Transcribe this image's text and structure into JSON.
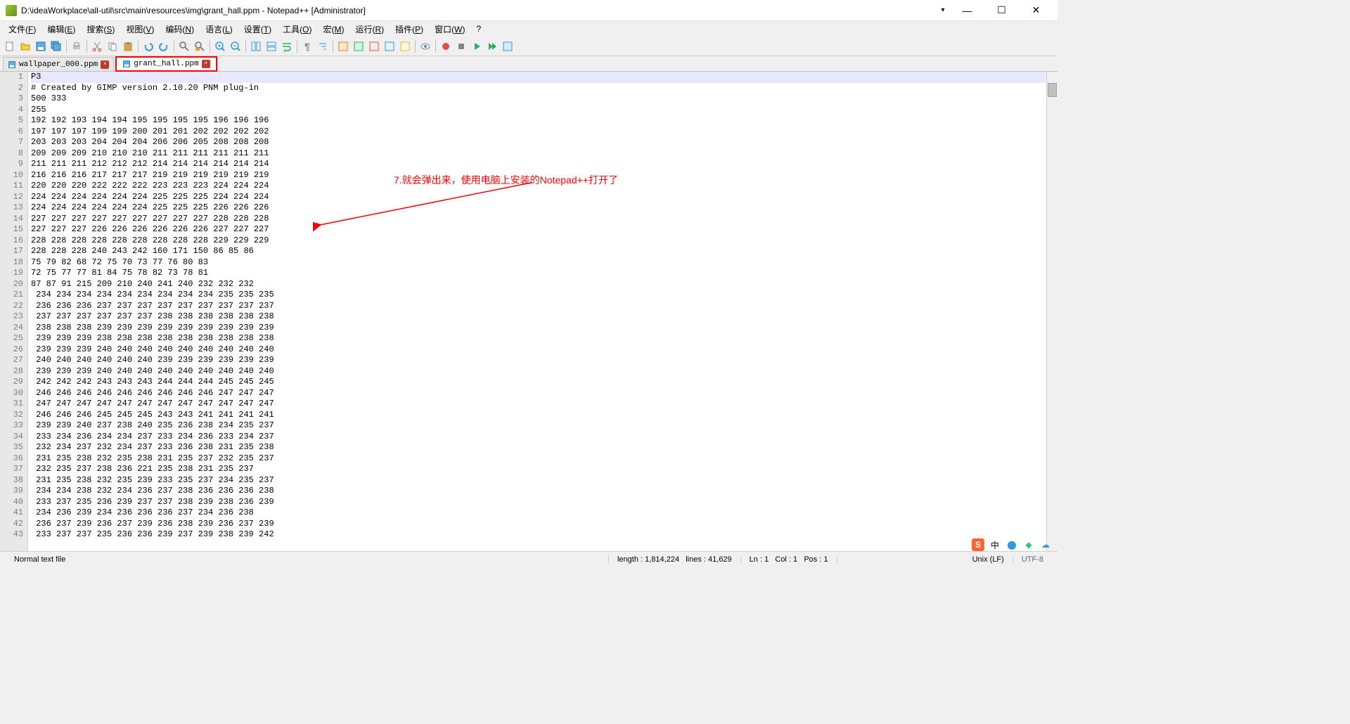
{
  "title": "D:\\ideaWorkplace\\all-util\\src\\main\\resources\\img\\grant_hall.ppm - Notepad++ [Administrator]",
  "menus": [
    {
      "label": "文件(F)",
      "key": "F"
    },
    {
      "label": "编辑(E)",
      "key": "E"
    },
    {
      "label": "搜索(S)",
      "key": "S"
    },
    {
      "label": "视图(V)",
      "key": "V"
    },
    {
      "label": "编码(N)",
      "key": "N"
    },
    {
      "label": "语言(L)",
      "key": "L"
    },
    {
      "label": "设置(T)",
      "key": "T"
    },
    {
      "label": "工具(O)",
      "key": "O"
    },
    {
      "label": "宏(M)",
      "key": "M"
    },
    {
      "label": "运行(R)",
      "key": "R"
    },
    {
      "label": "插件(P)",
      "key": "P"
    },
    {
      "label": "窗口(W)",
      "key": "W"
    },
    {
      "label": "?",
      "key": ""
    }
  ],
  "tabs": [
    {
      "name": "wallpaper_000.ppm",
      "active": false
    },
    {
      "name": "grant_hall.ppm",
      "active": true
    }
  ],
  "lines": [
    "P3",
    "# Created by GIMP version 2.10.20 PNM plug-in",
    "500 333",
    "255",
    "192 192 193 194 194 195 195 195 195 196 196 196",
    "197 197 197 199 199 200 201 201 202 202 202 202",
    "203 203 203 204 204 204 206 206 205 208 208 208",
    "209 209 209 210 210 210 211 211 211 211 211 211",
    "211 211 211 212 212 212 214 214 214 214 214 214",
    "216 216 216 217 217 217 219 219 219 219 219 219",
    "220 220 220 222 222 222 223 223 223 224 224 224",
    "224 224 224 224 224 224 225 225 225 224 224 224",
    "224 224 224 224 224 224 225 225 225 226 226 226",
    "227 227 227 227 227 227 227 227 227 228 228 228",
    "227 227 227 226 226 226 226 226 226 227 227 227",
    "228 228 228 228 228 228 228 228 228 229 229 229",
    "228 228 228 240 243 242 160 171 150 86 85 86",
    "75 79 82 68 72 75 70 73 77 76 80 83",
    "72 75 77 77 81 84 75 78 82 73 78 81",
    "87 87 91 215 209 210 240 241 240 232 232 232",
    " 234 234 234 234 234 234 234 234 234 235 235 235",
    " 236 236 236 237 237 237 237 237 237 237 237 237",
    " 237 237 237 237 237 237 238 238 238 238 238 238",
    " 238 238 238 239 239 239 239 239 239 239 239 239",
    " 239 239 239 238 238 238 238 238 238 238 238 238",
    " 239 239 239 240 240 240 240 240 240 240 240 240",
    " 240 240 240 240 240 240 239 239 239 239 239 239",
    " 239 239 239 240 240 240 240 240 240 240 240 240",
    " 242 242 242 243 243 243 244 244 244 245 245 245",
    " 246 246 246 246 246 246 246 246 246 247 247 247",
    " 247 247 247 247 247 247 247 247 247 247 247 247",
    " 246 246 246 245 245 245 243 243 241 241 241 241",
    " 239 239 240 237 238 240 235 236 238 234 235 237",
    " 233 234 236 234 234 237 233 234 236 233 234 237",
    " 232 234 237 232 234 237 233 236 238 231 235 238",
    " 231 235 238 232 235 238 231 235 237 232 235 237",
    " 232 235 237 238 236 221 235 238 231 235 237",
    " 231 235 238 232 235 239 233 235 237 234 235 237",
    " 234 234 238 232 234 236 237 238 236 236 236 238",
    " 233 237 235 236 239 237 237 238 239 238 236 239",
    " 234 236 239 234 236 236 236 237 234 236 238",
    " 236 237 239 236 237 239 236 238 239 236 237 239",
    " 233 237 237 235 236 236 239 237 239 238 239 242"
  ],
  "annotation": "7.就会弹出来，使用电脑上安装的Notepad++打开了",
  "status": {
    "type": "Normal text file",
    "length": "length : 1,814,224",
    "lines": "lines : 41,629",
    "ln": "Ln : 1",
    "col": "Col : 1",
    "pos": "Pos : 1",
    "eol": "Unix (LF)",
    "encoding": "UTF-8"
  },
  "tray": {
    "ime_lang": "中",
    "ime_mode": "S"
  }
}
